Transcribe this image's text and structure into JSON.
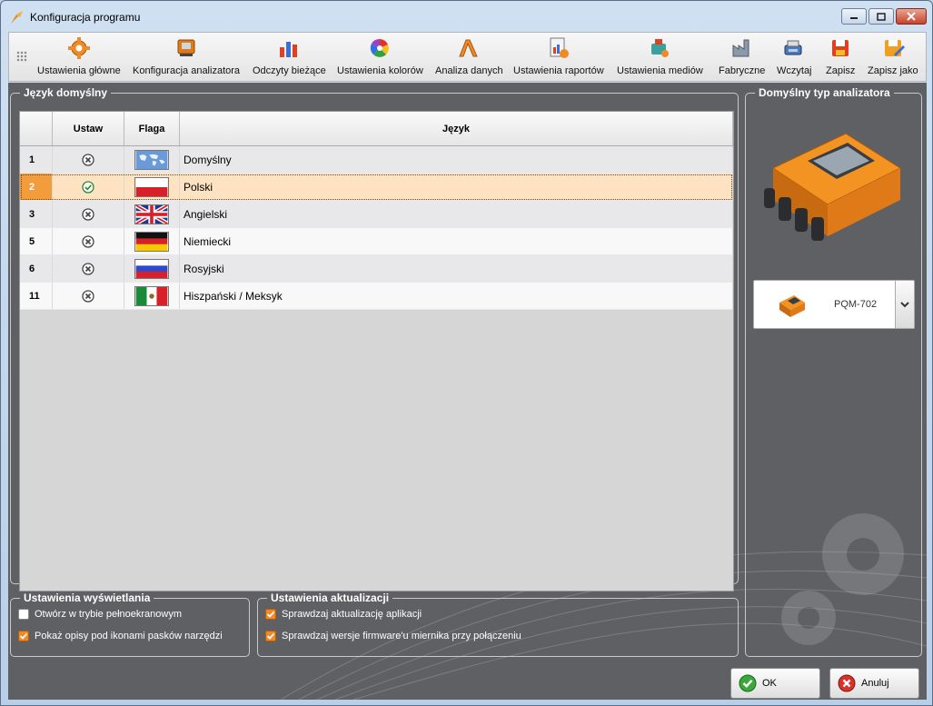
{
  "window": {
    "title": "Konfiguracja programu"
  },
  "toolbar": {
    "items": [
      {
        "label": "Ustawienia główne",
        "icon": "gear-icon"
      },
      {
        "label": "Konfiguracja analizatora",
        "icon": "analyzer-config-icon"
      },
      {
        "label": "Odczyty bieżące",
        "icon": "bar-readings-icon"
      },
      {
        "label": "Ustawienia kolorów",
        "icon": "color-wheel-icon"
      },
      {
        "label": "Analiza danych",
        "icon": "data-analysis-icon"
      },
      {
        "label": "Ustawienia raportów",
        "icon": "report-icon"
      },
      {
        "label": "Ustawienia mediów",
        "icon": "media-icon"
      },
      {
        "label": "Fabryczne",
        "icon": "factory-icon"
      },
      {
        "label": "Wczytaj",
        "icon": "load-icon"
      },
      {
        "label": "Zapisz",
        "icon": "save-icon"
      },
      {
        "label": "Zapisz jako",
        "icon": "save-as-icon"
      }
    ]
  },
  "language_group": {
    "title": "Język domyślny",
    "columns": {
      "id": "",
      "set": "Ustaw",
      "flag": "Flaga",
      "language": "Język"
    },
    "rows": [
      {
        "id": "1",
        "set": false,
        "flag": "world",
        "language": "Domyślny"
      },
      {
        "id": "2",
        "set": true,
        "flag": "pl",
        "language": "Polski"
      },
      {
        "id": "3",
        "set": false,
        "flag": "gb",
        "language": "Angielski"
      },
      {
        "id": "5",
        "set": false,
        "flag": "de",
        "language": "Niemiecki"
      },
      {
        "id": "6",
        "set": false,
        "flag": "ru",
        "language": "Rosyjski"
      },
      {
        "id": "11",
        "set": false,
        "flag": "mx",
        "language": "Hiszpański / Meksyk"
      }
    ],
    "selected_id": "2"
  },
  "display_settings": {
    "title": "Ustawienia wyświetlania",
    "fullscreen": {
      "label": "Otwórz w trybie pełnoekranowym",
      "checked": false
    },
    "toolbar_labels": {
      "label": "Pokaż opisy pod ikonami pasków narzędzi",
      "checked": true
    }
  },
  "update_settings": {
    "title": "Ustawienia aktualizacji",
    "check_app": {
      "label": "Sprawdzaj aktualizację aplikacji",
      "checked": true
    },
    "check_firmware": {
      "label": "Sprawdzaj wersje firmware'u miernika przy połączeniu",
      "checked": true
    }
  },
  "analyzer_group": {
    "title": "Domyślny typ analizatora",
    "selected": "PQM-702"
  },
  "buttons": {
    "ok": "OK",
    "cancel": "Anuluj"
  },
  "colors": {
    "accent": "#f08a24",
    "panel_bg": "#5e6064",
    "selected_row": "#fde3c2"
  }
}
